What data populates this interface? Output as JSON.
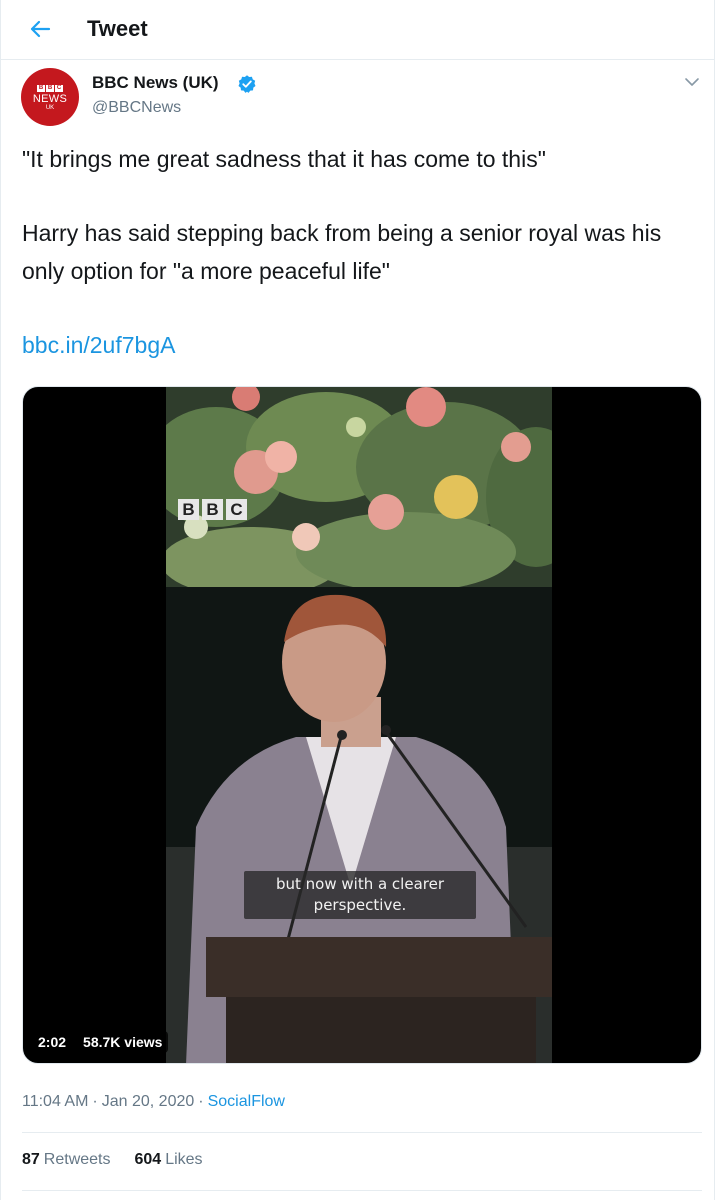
{
  "header": {
    "title": "Tweet",
    "back_icon": "arrow-left-icon",
    "accent_color": "#1da1f2"
  },
  "author": {
    "name": "BBC News (UK)",
    "handle": "@BBCNews",
    "verified_icon": "verified-badge-icon",
    "avatar": {
      "line1": [
        "B",
        "B",
        "C"
      ],
      "line2": "NEWS",
      "line3": "UK",
      "color": "#c4181e"
    },
    "menu_icon": "chevron-down-icon"
  },
  "tweet": {
    "quote": "\"It brings me great sadness that it has come to this\"",
    "body": "Harry has said stepping back from being a senior royal was his only option for \"a more peaceful life\"",
    "link": "bbc.in/2uf7bgA"
  },
  "media": {
    "logo_letters": [
      "B",
      "B",
      "C"
    ],
    "subtitle": "but now with a clearer perspective.",
    "duration": "2:02",
    "views": "58.7K views"
  },
  "meta": {
    "time": "11:04 AM",
    "date": "Jan 20, 2020",
    "app": "SocialFlow",
    "separator": "·",
    "link_color": "#1b95e0"
  },
  "stats": {
    "retweets_count": "87",
    "retweets_label": "Retweets",
    "likes_count": "604",
    "likes_label": "Likes"
  }
}
